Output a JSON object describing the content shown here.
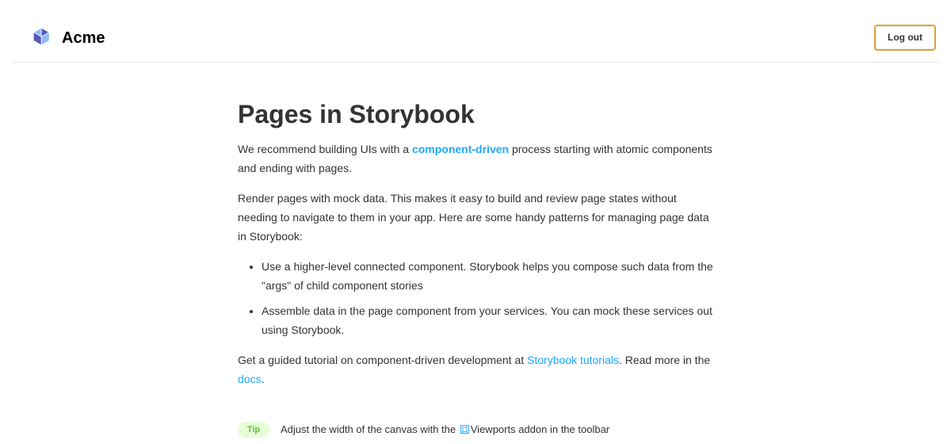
{
  "header": {
    "brand": "Acme",
    "logout_label": "Log out",
    "logo_icon": "acme-cube-icon",
    "colors": {
      "button_border": "#e0a33a"
    }
  },
  "main": {
    "title": "Pages in Storybook",
    "p1": {
      "before": "We recommend building UIs with a ",
      "link": "component-driven",
      "after": " process starting with atomic components and ending with pages."
    },
    "p2": "Render pages with mock data. This makes it easy to build and review page states without needing to navigate to them in your app. Here are some handy patterns for managing page data in Storybook:",
    "bullets": [
      "Use a higher-level connected component. Storybook helps you compose such data from the \"args\" of child component stories",
      "Assemble data in the page component from your services. You can mock these services out using Storybook."
    ],
    "p3": {
      "before": "Get a guided tutorial on component-driven development at ",
      "link1": "Storybook tutorials",
      "middle": ". Read more in the ",
      "link2": "docs",
      "after": "."
    },
    "colors": {
      "link": "#1ea7fd"
    }
  },
  "tip": {
    "badge": "Tip",
    "before": "Adjust the width of the canvas with the ",
    "icon": "viewports-icon",
    "after": "Viewports addon in the toolbar",
    "colors": {
      "badge_bg": "#e7fdd8",
      "badge_text": "#66bf3c"
    }
  }
}
